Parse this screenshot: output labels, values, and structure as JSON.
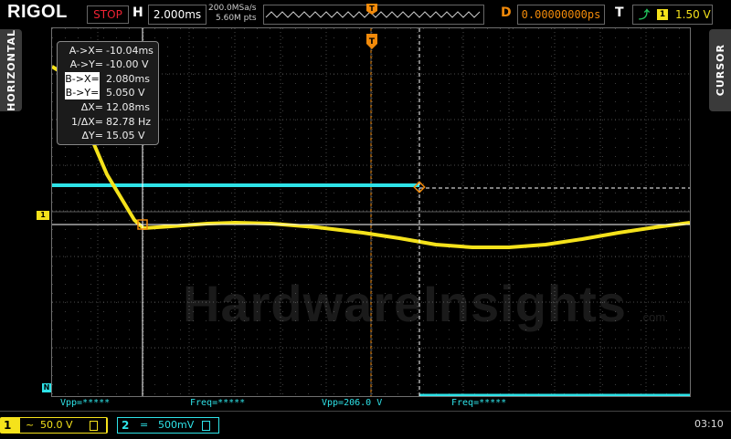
{
  "header": {
    "brand": "RIGOL",
    "run_state": "STOP",
    "h_label": "H",
    "timebase": "2.000ms",
    "sample_rate": "200.0MSa/s",
    "mem_depth": "5.60M pts",
    "d_label": "D",
    "delay": "0.00000000ps",
    "t_label": "T",
    "trigger_source": "1",
    "trigger_level": "1.50 V"
  },
  "side_tabs": {
    "left": "HORIZONTAL",
    "right": "CURSOR"
  },
  "cursor_readout": [
    {
      "label": "A->X=",
      "value": "-10.04ms",
      "highlight": false
    },
    {
      "label": "A->Y=",
      "value": "-10.00 V",
      "highlight": false
    },
    {
      "label": "B->X=",
      "value": "2.080ms",
      "highlight": true
    },
    {
      "label": "B->Y=",
      "value": "5.050 V",
      "highlight": true
    },
    {
      "label": "ΔX=",
      "value": "12.08ms",
      "highlight": false
    },
    {
      "label": "1/ΔX=",
      "value": "82.78 Hz",
      "highlight": false
    },
    {
      "label": "ΔY=",
      "value": "15.05 V",
      "highlight": false
    }
  ],
  "markers": {
    "ch1": "1",
    "ch2": "N"
  },
  "measurements": [
    {
      "text": "Vpp=*****"
    },
    {
      "text": "Freq=*****"
    },
    {
      "text": "Vpp=206.0 V"
    },
    {
      "text": "Freq=*****"
    }
  ],
  "channels": {
    "ch1": {
      "number": "1",
      "coupling": "~",
      "scale": "50.0 V"
    },
    "ch2": {
      "number": "2",
      "coupling": "=",
      "scale": "500mV"
    }
  },
  "clock": "03:10",
  "watermark": {
    "main": "HardwareInsights",
    "suffix": ".com"
  },
  "colors": {
    "ch1": "#f5e21b",
    "ch2": "#2ee3e8",
    "trigger": "#f28a0a",
    "stop": "#e02a2a"
  }
}
